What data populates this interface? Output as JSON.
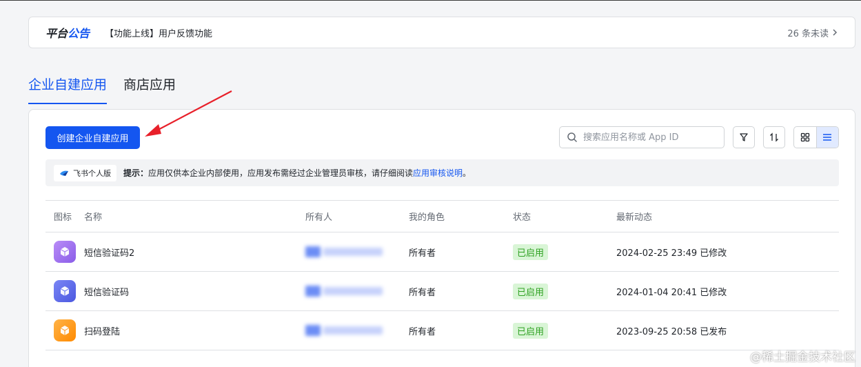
{
  "announcement": {
    "brand_part1": "平台",
    "brand_part2": "公告",
    "text": "【功能上线】用户反馈功能",
    "unread": "26 条未读"
  },
  "tabs": [
    {
      "label": "企业自建应用",
      "active": true
    },
    {
      "label": "商店应用",
      "active": false
    }
  ],
  "toolbar": {
    "create_label": "创建企业自建应用",
    "search_placeholder": "搜索应用名称或 App ID"
  },
  "hint": {
    "badge_label": "飞书个人版",
    "prefix": "提示：",
    "body": "应用仅供本企业内部使用，应用发布需经过企业管理员审核，请仔细阅读 ",
    "link": "应用审核说明",
    "suffix": "。"
  },
  "table": {
    "columns": [
      "图标",
      "名称",
      "所有人",
      "我的角色",
      "状态",
      "最新动态"
    ],
    "rows": [
      {
        "name": "短信验证码2",
        "role": "所有者",
        "status": "已启用",
        "updated": "2024-02-25 23:49 已修改",
        "icon_color": "#9b6cf0"
      },
      {
        "name": "短信验证码",
        "role": "所有者",
        "status": "已启用",
        "updated": "2024-01-04 20:41 已修改",
        "icon_color": "#5b6cf0"
      },
      {
        "name": "扫码登陆",
        "role": "所有者",
        "status": "已启用",
        "updated": "2023-09-25 20:58 已发布",
        "icon_color": "#ff9a1f"
      }
    ]
  },
  "watermark": "@稀土掘金技术社区",
  "colors": {
    "accent": "#1456f0",
    "status_bg": "#d9f5d6",
    "status_text": "#2ea121"
  }
}
